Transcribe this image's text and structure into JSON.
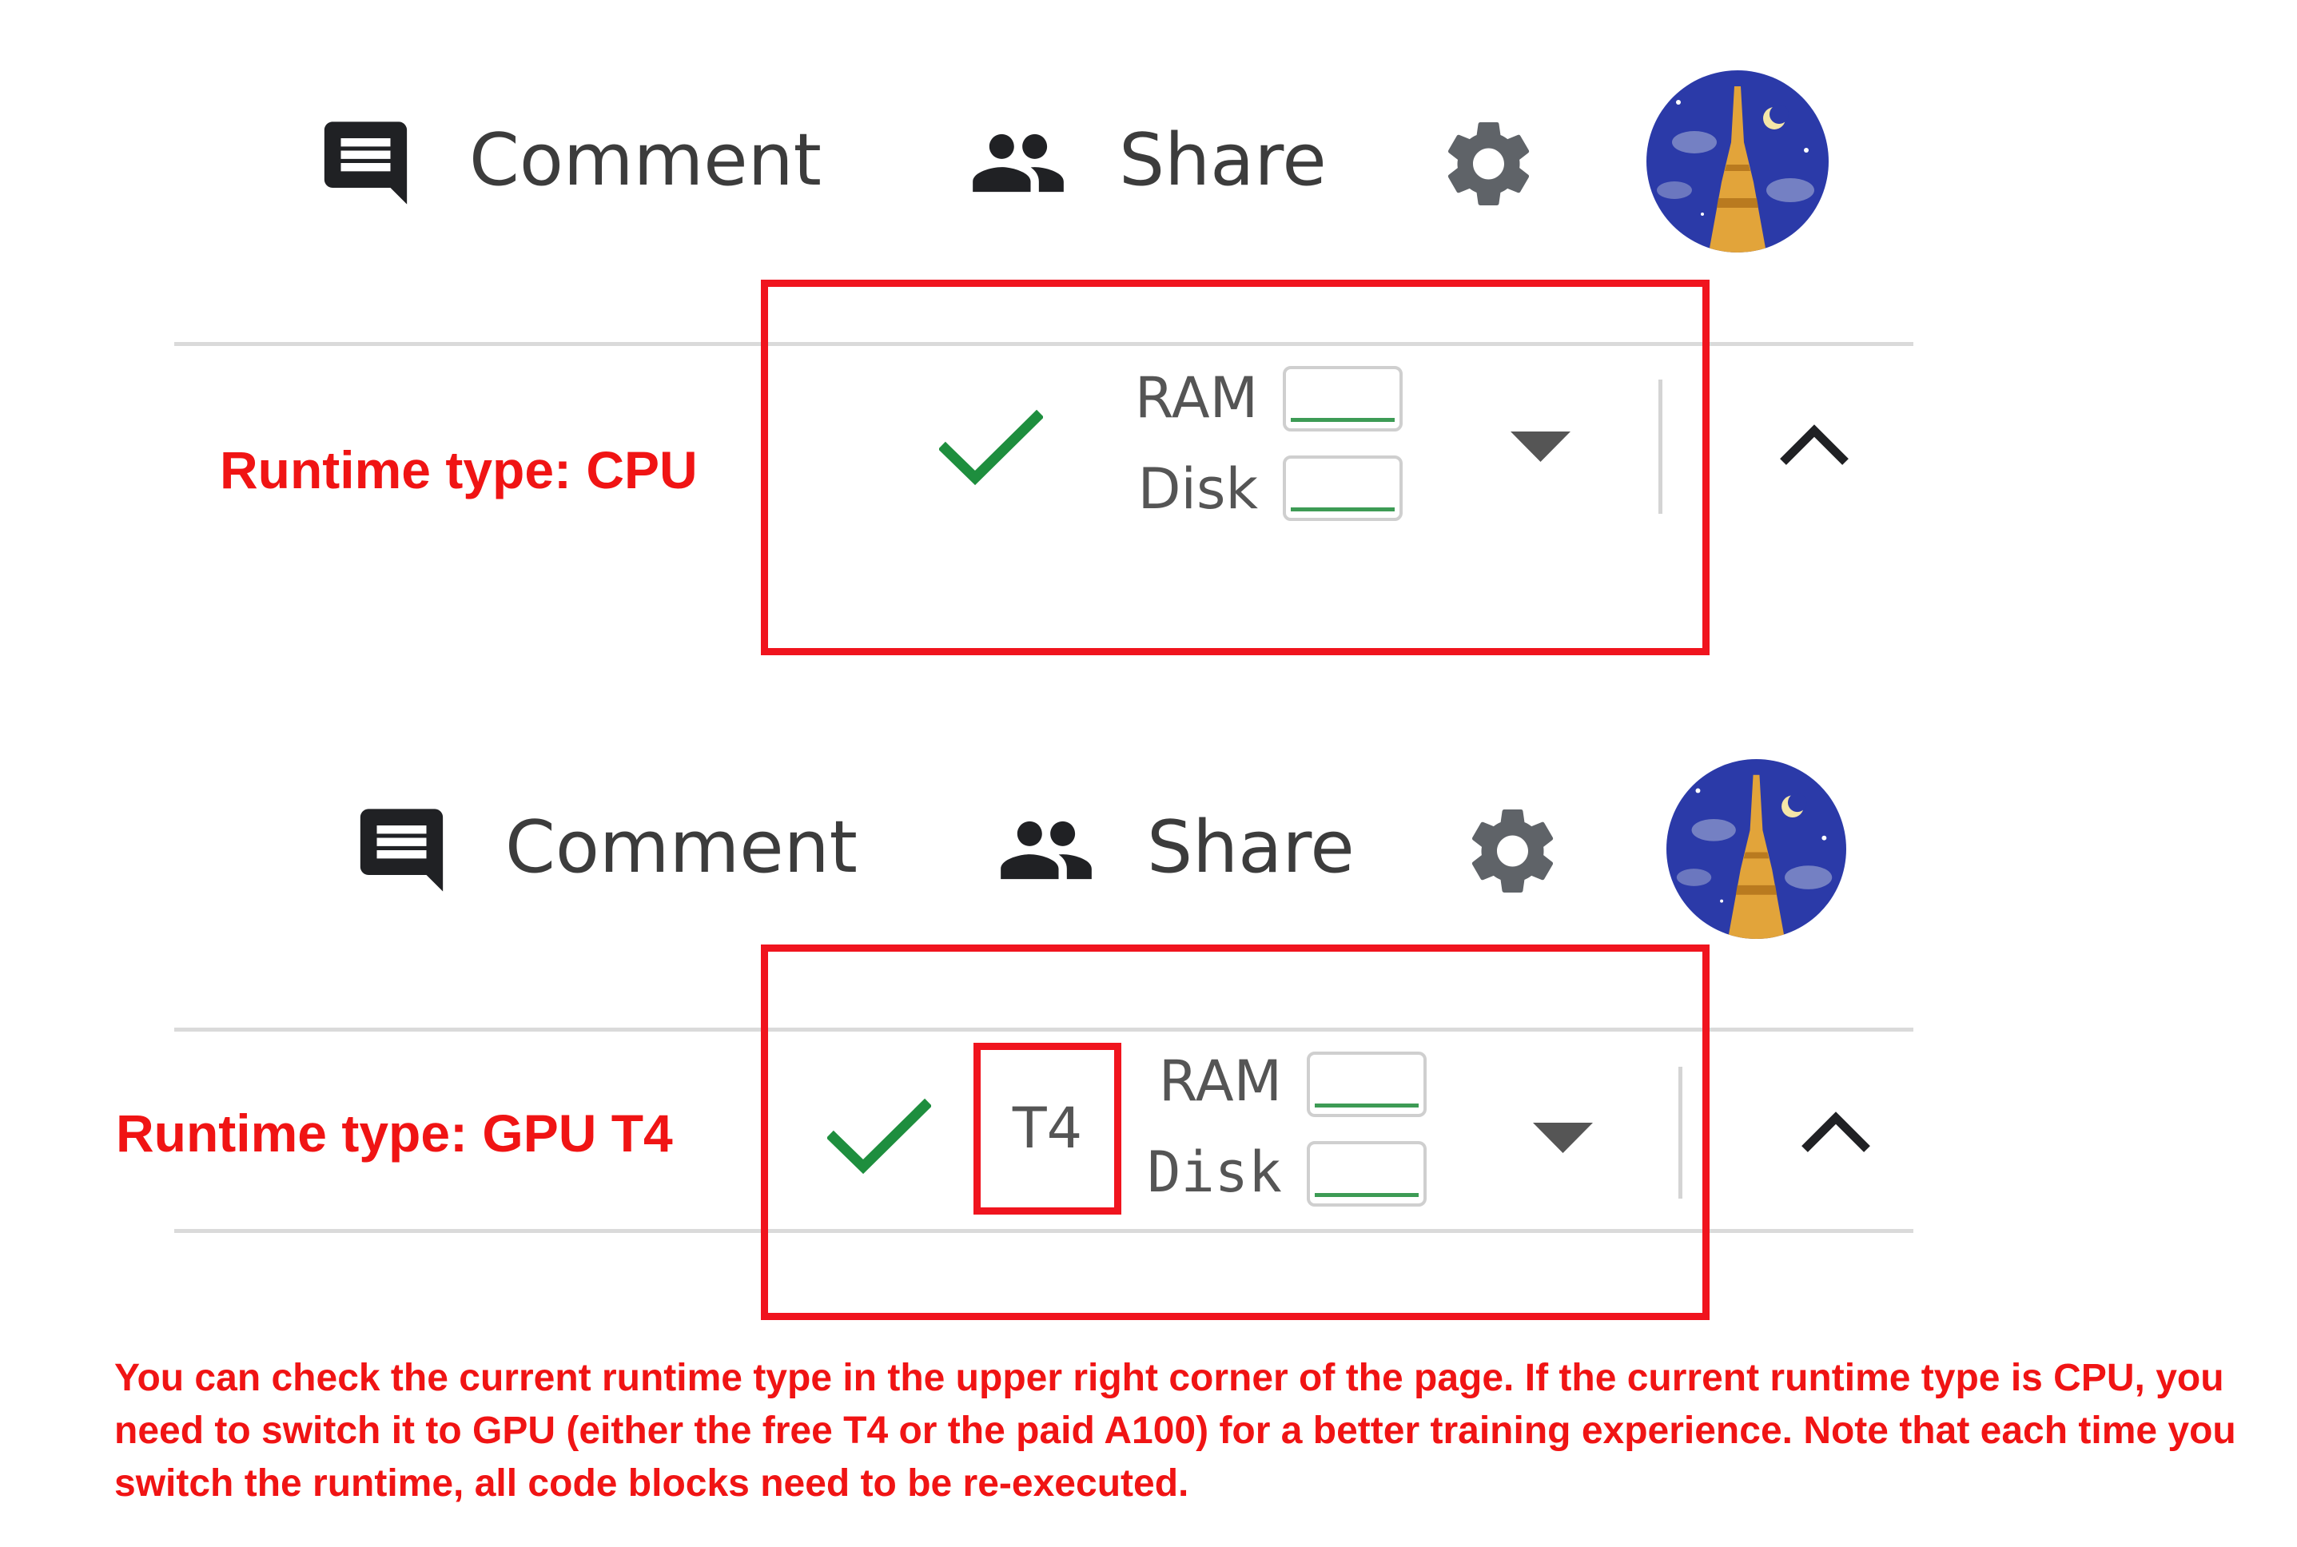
{
  "toolbar": {
    "comment_label": "Comment",
    "share_label": "Share"
  },
  "icons": {
    "comment": "comment-icon",
    "share": "people-icon",
    "settings": "gear-icon",
    "avatar": "eiffel-tower-night-avatar",
    "connected": "check-icon",
    "dropdown": "caret-down-icon",
    "collapse": "chevron-up-icon"
  },
  "colors": {
    "annotation_red": "#f01414",
    "check_green": "#1e8e3e",
    "meter_green": "#3d9b55",
    "avatar_bg": "#2b3aa8",
    "tower_gold": "#e2a43a"
  },
  "panels": [
    {
      "caption": "Runtime type: CPU",
      "resources": {
        "ram_label": "RAM",
        "disk_label": "Disk",
        "ram_usage": 0.0,
        "disk_usage": 0.0
      }
    },
    {
      "caption": "Runtime type: GPU T4",
      "gpu_badge": "T4",
      "resources": {
        "ram_label": "RAM",
        "disk_label": "Disk",
        "ram_usage": 0.0,
        "disk_usage": 0.0
      }
    }
  ],
  "note": "You can check the current runtime type in the upper right corner of the page. If the current runtime type is CPU, you need to switch it to GPU (either the free T4 or the paid A100) for a better training experience. Note that each time you switch the runtime, all code blocks need to be re-executed."
}
